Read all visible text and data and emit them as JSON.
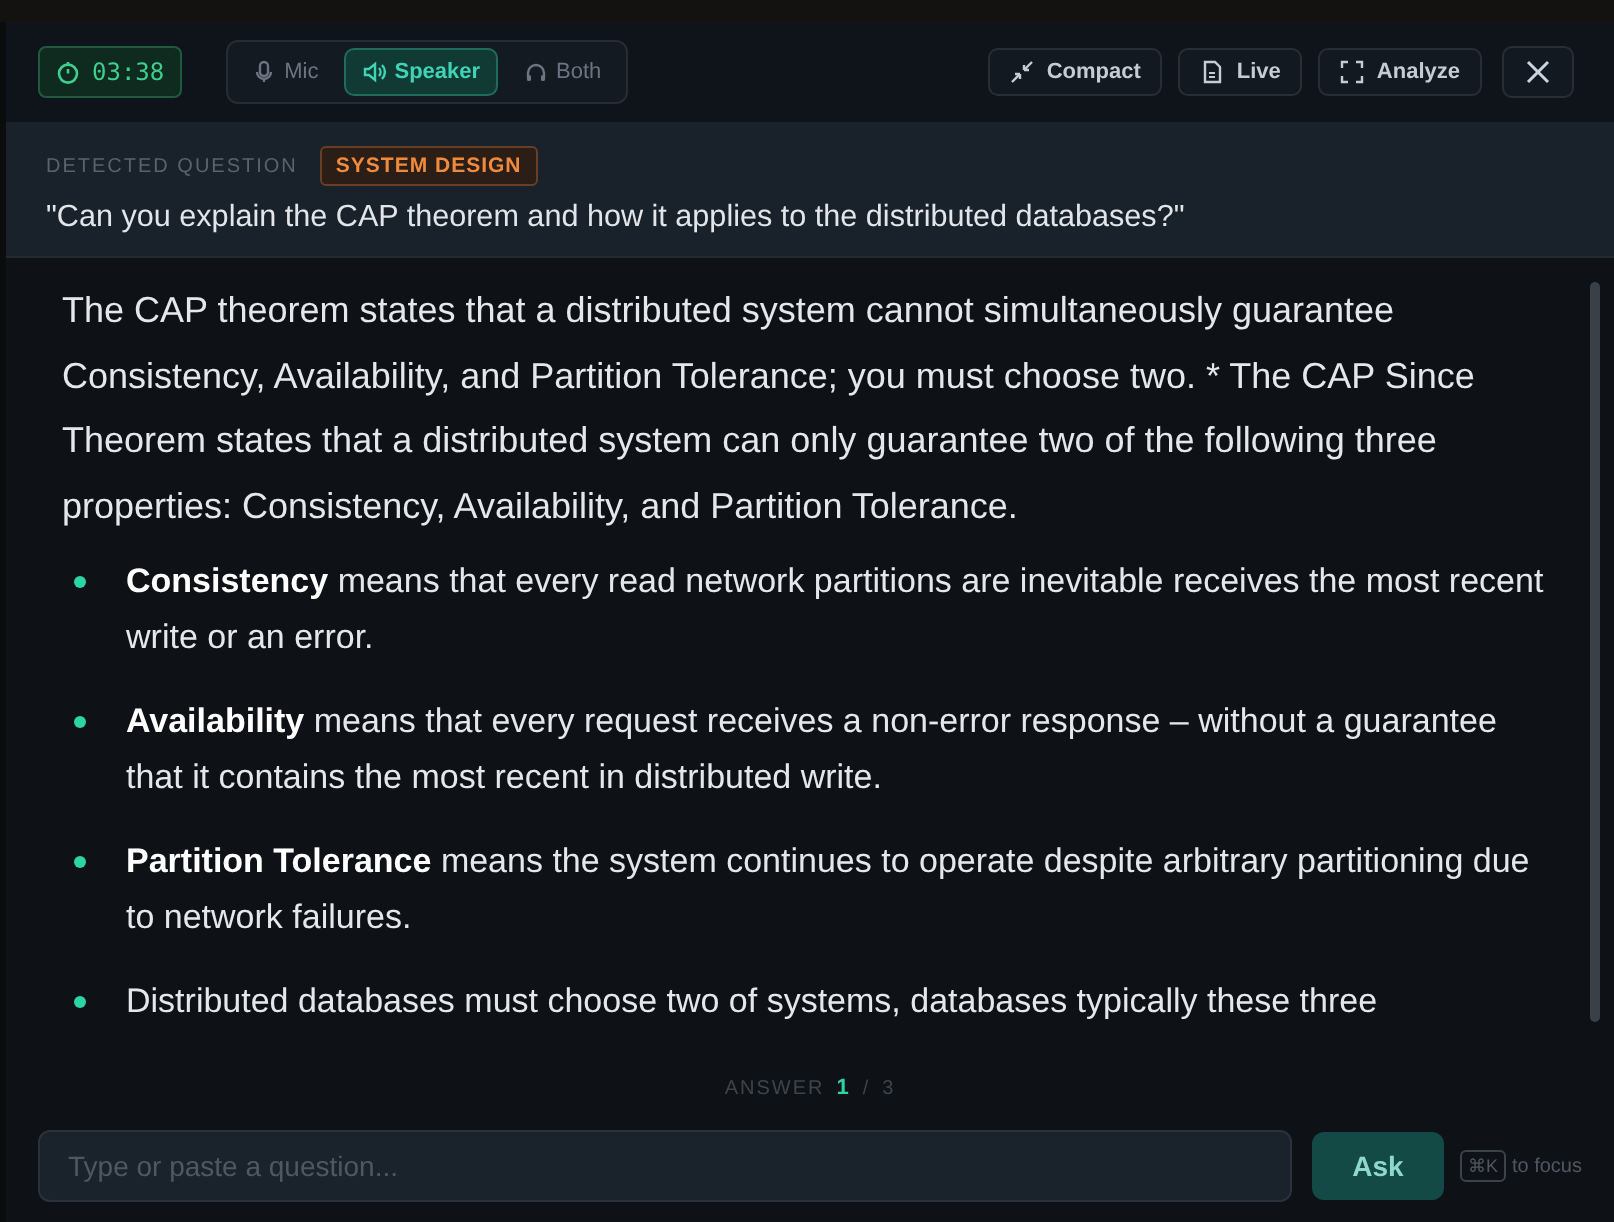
{
  "timer": "03:38",
  "modes": [
    {
      "label": "Mic",
      "selected": false
    },
    {
      "label": "Speaker",
      "selected": true
    },
    {
      "label": "Both",
      "selected": false
    }
  ],
  "actions": [
    {
      "label": "Compact"
    },
    {
      "label": "Live"
    },
    {
      "label": "Analyze"
    }
  ],
  "question": {
    "label": "DETECTED QUESTION",
    "tag": "SYSTEM DESIGN",
    "text": "\"Can you explain the CAP theorem and how it applies to the distributed databases?\""
  },
  "answer": {
    "paragraph": "The CAP theorem states that a distributed system cannot simultaneously guarantee Consistency, Availability, and Partition Tolerance; you must choose two. * The CAP Since Theorem states that a distributed system can only guarantee two of the following three properties: Consistency, Availability, and Partition Tolerance.",
    "bullets": [
      "**Consistency** means that every read network partitions are inevitable receives the most recent write or an error.",
      "**Availability** means that every request receives a non-error response – without a guarantee that it contains the most recent in distributed write.",
      "**Partition Tolerance** means the system continues to operate despite arbitrary partitioning due to network failures.",
      "Distributed databases must choose two of systems, databases typically these three"
    ]
  },
  "pager": {
    "label": "ANSWER",
    "current": "1",
    "separator": "/",
    "total": "3"
  },
  "input": {
    "placeholder": "Type or paste a question..."
  },
  "ask_button": "Ask",
  "shortcut": {
    "key": "⌘K",
    "hint": "to focus"
  }
}
